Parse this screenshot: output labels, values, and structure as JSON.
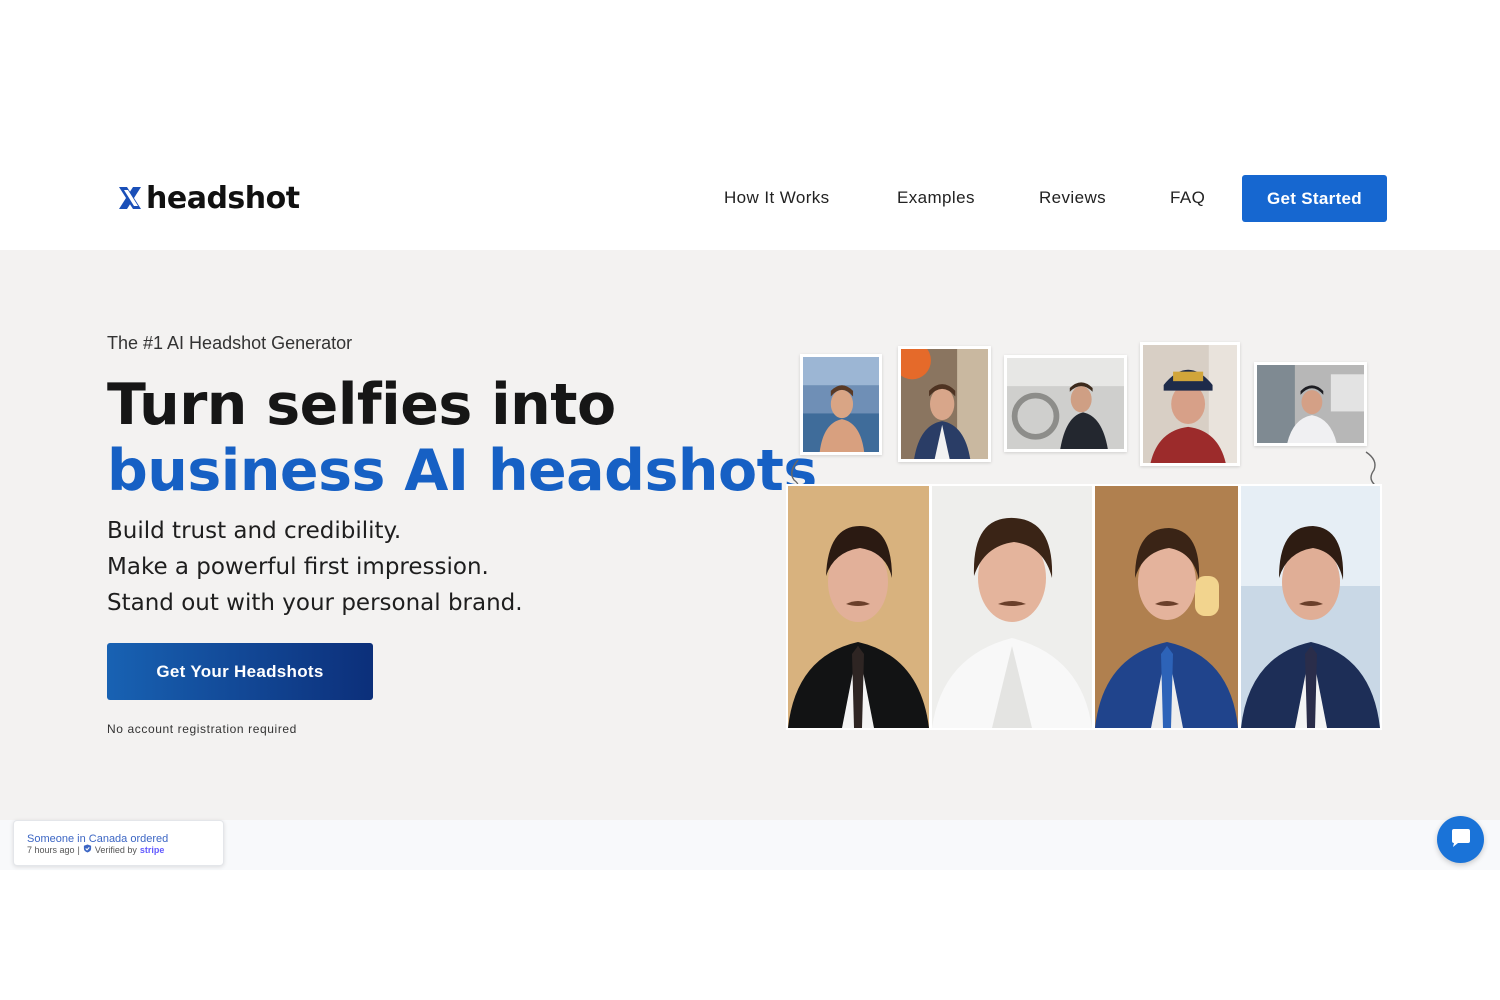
{
  "header": {
    "logo_text": "headshot",
    "nav": [
      {
        "label": "How It Works"
      },
      {
        "label": "Examples"
      },
      {
        "label": "Reviews"
      },
      {
        "label": "FAQ"
      }
    ],
    "cta_label": "Get Started",
    "accent_color": "#1667d0"
  },
  "hero": {
    "eyebrow": "The #1 AI Headshot Generator",
    "headline_line1": "Turn selfies into",
    "headline_line2": "business AI headshots",
    "bullets": [
      "Build trust and credibility.",
      "Make a powerful first impression.",
      "Stand out with your personal brand."
    ],
    "cta_label": "Get Your Headshots",
    "cta_note": "No account registration required",
    "headline_accent_color": "#1660c4"
  },
  "toast": {
    "line1": "Someone in Canada ordered",
    "time": "7 hours ago",
    "verified_label": "Verified by",
    "verified_brand": "stripe"
  },
  "icons": {
    "logo": "x-logo-icon",
    "chat": "chat-bubble-icon",
    "verified": "shield-check-icon"
  }
}
